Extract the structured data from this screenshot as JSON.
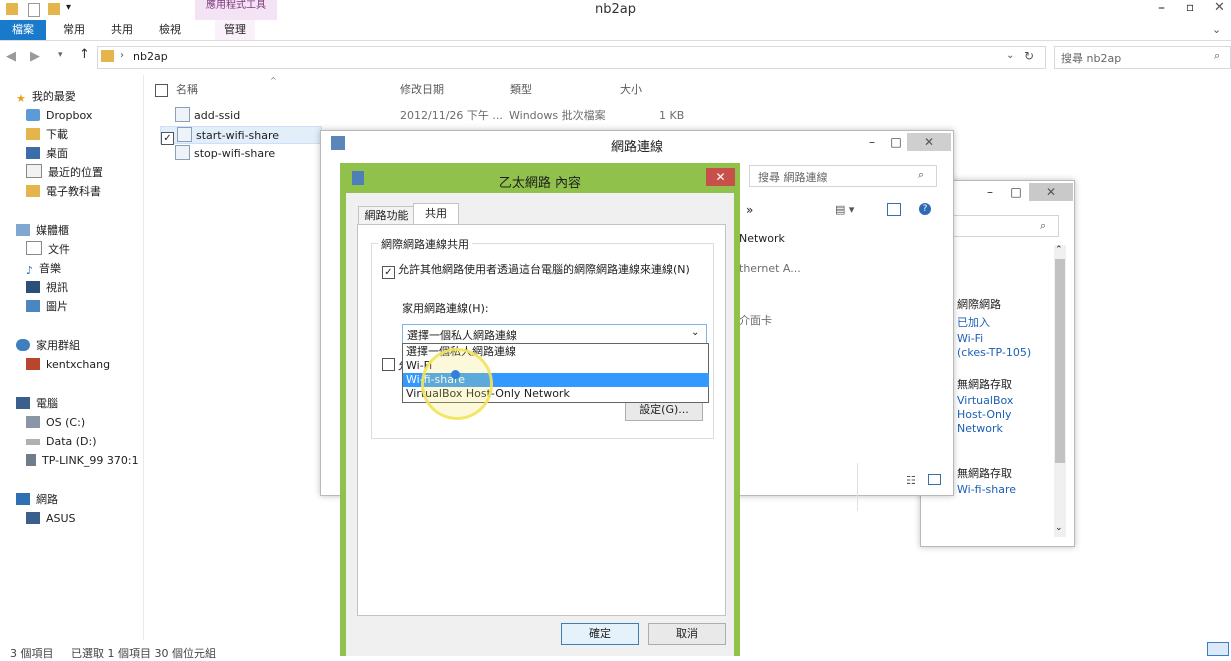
{
  "explorer": {
    "title": "nb2ap",
    "ribbon_context_tab": "應用程式工具",
    "ribbon_tabs": [
      "檔案",
      "常用",
      "共用",
      "檢視",
      "管理"
    ],
    "breadcrumb": "nb2ap",
    "search_placeholder": "搜尋 nb2ap",
    "columns": {
      "name": "名稱",
      "modified": "修改日期",
      "type": "類型",
      "size": "大小"
    },
    "files": [
      {
        "name": "add-ssid",
        "modified": "2012/11/26 下午 ...",
        "type": "Windows 批次檔案",
        "size": "1 KB"
      },
      {
        "name": "start-wifi-share",
        "modified": "",
        "type": "",
        "size": ""
      },
      {
        "name": "stop-wifi-share",
        "modified": "",
        "type": "",
        "size": ""
      }
    ],
    "nav": {
      "favorites": "我的最愛",
      "dropbox": "Dropbox",
      "downloads": "下載",
      "desktop": "桌面",
      "recent": "最近的位置",
      "ebooks": "電子教科書",
      "libraries": "媒體櫃",
      "documents": "文件",
      "music": "音樂",
      "videos": "視訊",
      "pictures": "圖片",
      "homegroup": "家用群組",
      "user": "kentxchang",
      "computer": "電腦",
      "drive_c": "OS (C:)",
      "drive_d": "Data (D:)",
      "tplink": "TP-LINK_99 370:1",
      "network": "網路",
      "asus": "ASUS"
    },
    "status": "3 個項目     已選取 1 個項目 30 個位元組"
  },
  "netconn": {
    "title": "網路連線",
    "search_placeholder": "搜尋 網路連線",
    "partial_texts": [
      "»",
      "Network",
      "thernet A...",
      "介面卡"
    ]
  },
  "detail_panel": {
    "groups": [
      {
        "label": "網際網路",
        "lines": [
          "已加入",
          "Wi-Fi",
          "(ckes-TP-105)"
        ]
      },
      {
        "label": "無網路存取",
        "lines": [
          "VirtualBox",
          "Host-Only",
          "Network"
        ]
      },
      {
        "label": "無網路存取",
        "lines": [
          "Wi-fi-share"
        ]
      }
    ]
  },
  "dialog": {
    "title": "乙太網路 內容",
    "tabs": [
      "網路功能",
      "共用"
    ],
    "group_label": "網際網路連線共用",
    "allow_checkbox": "允許其他網路使用者透過這台電腦的網際網路連線來連線(N)",
    "home_network_label": "家用網路連線(H):",
    "selected_value": "選擇一個私人網路連線",
    "options": [
      "選擇一個私人網路連線",
      "Wi-Fi",
      "Wi-fi-share",
      "VirtualBox Host-Only Network"
    ],
    "highlighted_option": "Wi-fi-share",
    "hidden_checkbox_fragment": "允",
    "settings_button": "設定(G)...",
    "ok_button": "確定",
    "cancel_button": "取消"
  },
  "colors": {
    "dialog_border": "#8fc14b",
    "highlight": "#3399ff",
    "annotation_red": "#d9262d",
    "cursor_yellow": "#f2e35a",
    "link_blue": "#1a5fb4"
  }
}
